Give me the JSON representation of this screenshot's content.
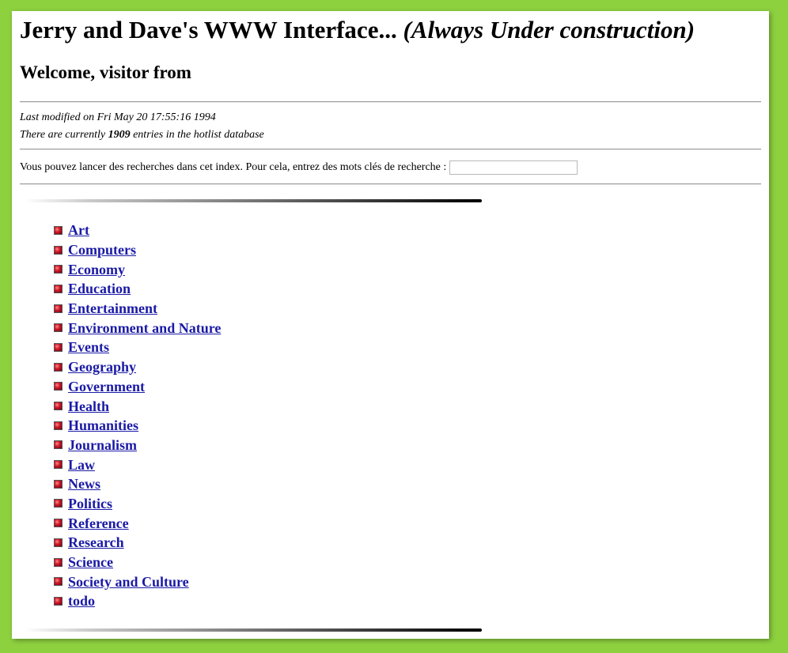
{
  "page": {
    "title": "Jerry and Dave's WWW Interface...",
    "subtitle": "(Always Under construction)",
    "welcome": "Welcome, visitor from"
  },
  "meta": {
    "last_modified": "Last modified on Fri May 20 17:55:16 1994",
    "entries_prefix": "There are currently",
    "entries_count": "1909",
    "entries_suffix": "entries in the hotlist database"
  },
  "search": {
    "prompt": "Vous pouvez lancer des recherches dans cet index. Pour cela, entrez des mots clés de recherche :",
    "value": ""
  },
  "colors": {
    "background": "#8ed13f",
    "link": "#1a1aa6",
    "bullet": "#d01a2a"
  },
  "categories": [
    {
      "label": "Art",
      "icon": "red-bullet-icon"
    },
    {
      "label": "Computers",
      "icon": "red-bullet-icon"
    },
    {
      "label": "Economy",
      "icon": "red-bullet-icon"
    },
    {
      "label": "Education",
      "icon": "red-bullet-icon"
    },
    {
      "label": "Entertainment",
      "icon": "red-bullet-icon"
    },
    {
      "label": "Environment and Nature",
      "icon": "red-bullet-icon"
    },
    {
      "label": "Events",
      "icon": "red-bullet-icon"
    },
    {
      "label": "Geography",
      "icon": "red-bullet-icon"
    },
    {
      "label": "Government",
      "icon": "red-bullet-icon"
    },
    {
      "label": "Health",
      "icon": "red-bullet-icon"
    },
    {
      "label": "Humanities",
      "icon": "red-bullet-icon"
    },
    {
      "label": "Journalism",
      "icon": "red-bullet-icon"
    },
    {
      "label": "Law",
      "icon": "red-bullet-icon"
    },
    {
      "label": "News",
      "icon": "red-bullet-icon"
    },
    {
      "label": "Politics",
      "icon": "red-bullet-icon"
    },
    {
      "label": "Reference",
      "icon": "red-bullet-icon"
    },
    {
      "label": "Research",
      "icon": "red-bullet-icon"
    },
    {
      "label": "Science",
      "icon": "red-bullet-icon"
    },
    {
      "label": "Society and Culture",
      "icon": "red-bullet-icon"
    },
    {
      "label": "todo",
      "icon": "red-bullet-icon"
    }
  ]
}
